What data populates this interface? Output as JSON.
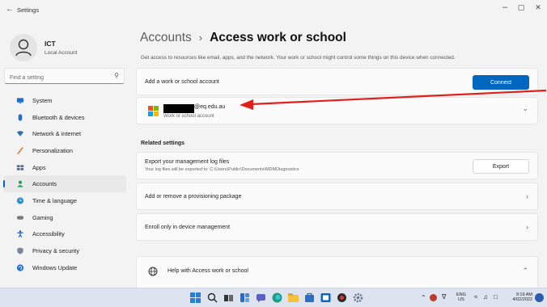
{
  "window": {
    "back_icon": "←",
    "title": "Settings",
    "minimize_icon": "–",
    "maximize_icon": "▢",
    "close_icon": "✕"
  },
  "profile": {
    "name": "ICT",
    "subtitle": "Local Account"
  },
  "search": {
    "placeholder": "Find a setting"
  },
  "nav": {
    "items": [
      {
        "label": "System",
        "icon": "monitor-icon",
        "color": "#1f6fd1"
      },
      {
        "label": "Bluetooth & devices",
        "icon": "bluetooth-icon",
        "color": "#1f6fd1"
      },
      {
        "label": "Network & internet",
        "icon": "wifi-icon",
        "color": "#2f6ca8"
      },
      {
        "label": "Personalization",
        "icon": "brush-icon",
        "color": "#d67f3c"
      },
      {
        "label": "Apps",
        "icon": "apps-icon",
        "color": "#5a6c85"
      },
      {
        "label": "Accounts",
        "icon": "accounts-icon",
        "color": "#1fa05a"
      },
      {
        "label": "Time & language",
        "icon": "globe-clock-icon",
        "color": "#2a8fd0"
      },
      {
        "label": "Gaming",
        "icon": "gamepad-icon",
        "color": "#7a7a7a"
      },
      {
        "label": "Accessibility",
        "icon": "accessibility-icon",
        "color": "#1f5fb4"
      },
      {
        "label": "Privacy & security",
        "icon": "shield-icon",
        "color": "#7a8597"
      },
      {
        "label": "Windows Update",
        "icon": "update-icon",
        "color": "#1a6fd0"
      }
    ],
    "active_index": 5
  },
  "header": {
    "parent": "Accounts",
    "separator": "›",
    "current": "Access work or school",
    "description": "Get access to resources like email, apps, and the network. Your work or school might control some things on this device when connected."
  },
  "add_account": {
    "label": "Add a work or school account",
    "button": "Connect"
  },
  "account": {
    "email_suffix": "@eq.edu.au",
    "type": "Work or school account",
    "chevron": "⌄"
  },
  "related": {
    "title": "Related settings",
    "export": {
      "title": "Export your management log files",
      "subtitle": "Your log files will be exported to: C:\\Users\\Public\\Documents\\MDMDiagnostics",
      "button": "Export"
    },
    "provisioning": "Add or remove a provisioning package",
    "enroll": "Enroll only in device management",
    "chevron": "›"
  },
  "help": {
    "label": "Help with Access work or school",
    "chevron": "⌃"
  },
  "taskbar": {
    "lang_top": "ENG",
    "lang_bottom": "US",
    "time": "9:19 AM",
    "date": "4/02/2022"
  },
  "colors": {
    "accent": "#0067c0",
    "annotation_arrow": "#e0201b"
  }
}
